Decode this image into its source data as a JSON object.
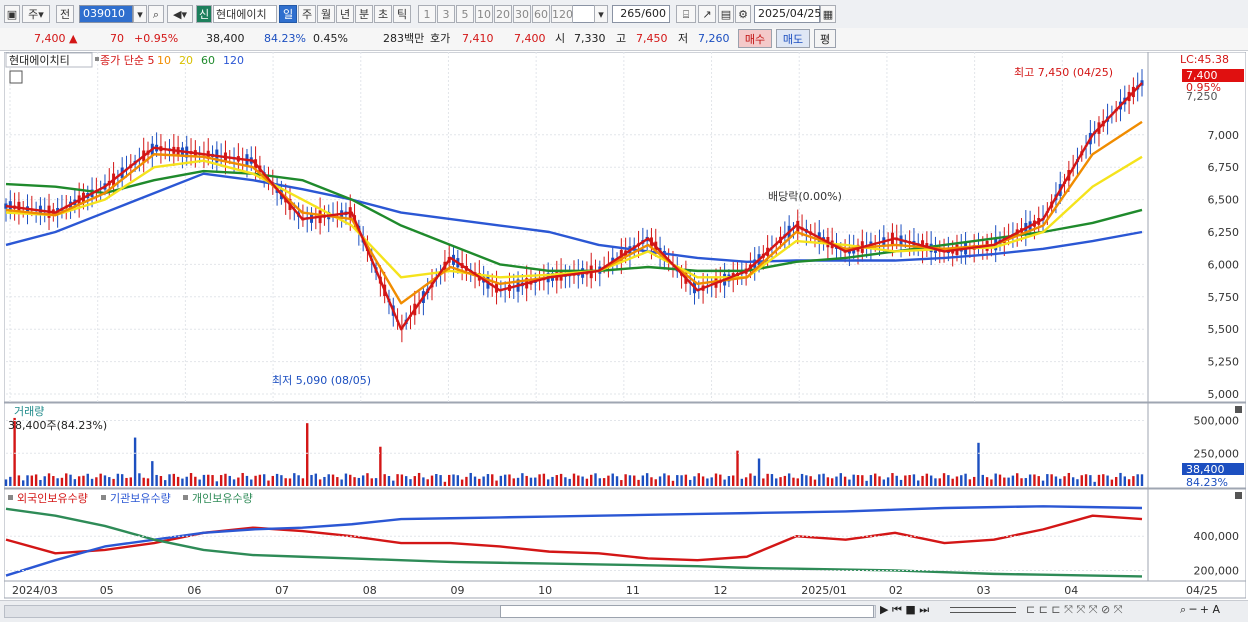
{
  "toolbar": {
    "mode1": "주",
    "mode2": "전",
    "code": "039010",
    "shin_badge": "신",
    "stock_name": "현대에이치",
    "periods": [
      "일",
      "주",
      "월",
      "년",
      "분",
      "초",
      "틱"
    ],
    "selected_period": "일",
    "intervals": [
      "1",
      "3",
      "5",
      "10",
      "20",
      "30",
      "60",
      "120"
    ],
    "count": "265",
    "count_total": "/600",
    "date": "2025/04/25"
  },
  "quote": {
    "price": "7,400",
    "change": "70",
    "change_pct": "+0.95%",
    "volume": "38,400",
    "volume_pct": "84.23%",
    "turnover": "0.45%",
    "amount": "283백만",
    "hoga_label": "호가",
    "ask": "7,410",
    "bid": "7,400",
    "open_label": "시",
    "open": "7,330",
    "high_label": "고",
    "high": "7,450",
    "low_label": "저",
    "low": "7,260",
    "buy_label": "매수",
    "sell_label": "매도",
    "eval_label": "평"
  },
  "chart_data": [
    {
      "type": "line",
      "title": "현대에이치티",
      "legend": [
        "종가 단순 5",
        "10",
        "20",
        "60",
        "120"
      ],
      "ylim": [
        5000,
        7500
      ],
      "y_ticks": [
        "7,000",
        "6,750",
        "6,500",
        "6,250",
        "6,000",
        "5,750",
        "5,500",
        "5,250",
        "5,000"
      ],
      "right_labels": {
        "lc": "LC:45.38",
        "price": "7,400",
        "pct": "0.95%",
        "upper": "7,250"
      },
      "annotations": {
        "high": "최고 7,450 (04/25)",
        "low": "최저 5,090 (08/05)",
        "dividend": "배당락(0.00%)"
      },
      "x": [
        "2024/03",
        "05",
        "06",
        "07",
        "08",
        "09",
        "10",
        "11",
        "12",
        "2025/01",
        "02",
        "03",
        "04"
      ],
      "series": [
        {
          "name": "종가 단순 5",
          "color": "#d31616",
          "values": [
            6450,
            6400,
            6600,
            6900,
            6850,
            6800,
            6350,
            6400,
            5500,
            6050,
            5800,
            5900,
            5950,
            6200,
            5800,
            5950,
            6300,
            6100,
            6200,
            6100,
            6150,
            6350,
            7000,
            7400
          ]
        },
        {
          "name": "10",
          "color": "#f08c00",
          "values": [
            6420,
            6380,
            6550,
            6850,
            6830,
            6750,
            6400,
            6350,
            5700,
            5980,
            5850,
            5900,
            5950,
            6150,
            5850,
            5900,
            6250,
            6120,
            6150,
            6120,
            6150,
            6300,
            6850,
            7100
          ]
        },
        {
          "name": "20",
          "color": "#f5e31c",
          "values": [
            6400,
            6380,
            6500,
            6750,
            6800,
            6700,
            6500,
            6300,
            5900,
            5950,
            5900,
            5920,
            5950,
            6100,
            5900,
            5900,
            6180,
            6150,
            6100,
            6120,
            6130,
            6250,
            6600,
            6830
          ]
        },
        {
          "name": "60",
          "color": "#1f8a2c",
          "values": [
            6620,
            6600,
            6550,
            6650,
            6720,
            6700,
            6650,
            6500,
            6300,
            6150,
            6000,
            5950,
            5950,
            5980,
            5950,
            5950,
            6020,
            6050,
            6100,
            6150,
            6200,
            6250,
            6320,
            6420
          ]
        },
        {
          "name": "120",
          "color": "#2b57d4",
          "values": [
            6150,
            6250,
            6400,
            6550,
            6700,
            6650,
            6580,
            6500,
            6400,
            6350,
            6300,
            6250,
            6150,
            6100,
            6050,
            6020,
            6030,
            6030,
            6030,
            6050,
            6080,
            6120,
            6180,
            6250
          ]
        }
      ]
    },
    {
      "type": "bar",
      "title": "거래량",
      "current_label": "38,400주(84.23%)",
      "ylim": [
        0,
        550000
      ],
      "y_ticks": [
        "500,000",
        "250,000"
      ],
      "right_labels": {
        "value": "38,400",
        "pct": "84.23%"
      }
    },
    {
      "type": "line",
      "title": "외국인보유수량",
      "legend": [
        "외국인보유수량",
        "기관보유수량",
        "개인보유수량"
      ],
      "ylim": [
        150000,
        600000
      ],
      "y_ticks": [
        "400,000",
        "200,000"
      ],
      "series": [
        {
          "name": "외국인보유수량",
          "color": "#d31616",
          "values": [
            380000,
            300000,
            320000,
            360000,
            420000,
            450000,
            430000,
            400000,
            360000,
            360000,
            340000,
            310000,
            300000,
            270000,
            260000,
            280000,
            400000,
            380000,
            420000,
            360000,
            380000,
            440000,
            520000,
            500000
          ]
        },
        {
          "name": "기관보유수량",
          "color": "#2b57d4",
          "values": [
            170000,
            260000,
            340000,
            380000,
            420000,
            440000,
            450000,
            470000,
            500000,
            505000,
            510000,
            515000,
            520000,
            525000,
            530000,
            535000,
            540000,
            545000,
            555000,
            565000,
            570000,
            575000,
            570000,
            565000
          ]
        },
        {
          "name": "개인보유수량",
          "color": "#2e8b57",
          "values": [
            560000,
            520000,
            460000,
            380000,
            320000,
            290000,
            280000,
            270000,
            260000,
            250000,
            245000,
            240000,
            235000,
            230000,
            225000,
            215000,
            210000,
            205000,
            200000,
            190000,
            180000,
            175000,
            170000,
            165000
          ]
        }
      ]
    }
  ],
  "bottom": {
    "right_label": "04/25"
  }
}
